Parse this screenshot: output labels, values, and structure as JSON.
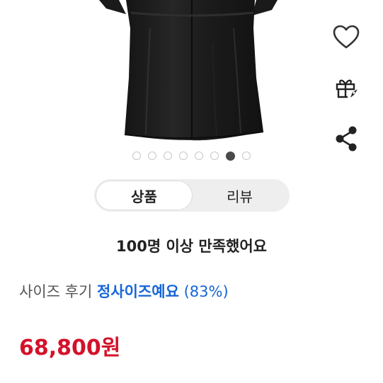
{
  "actions": {
    "like_icon": "heart-icon",
    "gift_icon": "gift-icon",
    "share_icon": "share-icon"
  },
  "carousel": {
    "total": 8,
    "active_index": 6
  },
  "tabs": [
    {
      "label": "상품",
      "active": true
    },
    {
      "label": "리뷰",
      "active": false
    }
  ],
  "satisfaction_text": "100명 이상 만족했어요",
  "size_review": {
    "label": "사이즈 후기",
    "value": "정사이즈예요",
    "percent": "(83%)"
  },
  "price": "68,800원",
  "colors": {
    "price": "#d3122a",
    "link": "#1565d8",
    "dot_active": "#4a4a4a"
  }
}
